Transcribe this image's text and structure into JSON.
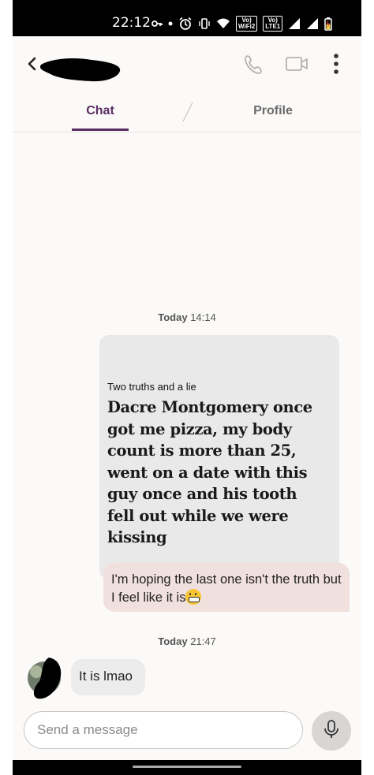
{
  "status_bar": {
    "time": "22:12",
    "wifi_badge": "Vo)\nWiFi2",
    "lte_badge": "Vo)\nLTE1"
  },
  "header": {
    "contact_name": "",
    "icons": [
      "back-arrow-icon",
      "phone-icon",
      "video-camera-icon",
      "more-vertical-icon"
    ]
  },
  "tabs": [
    {
      "label": "Chat",
      "active": true
    },
    {
      "label": "Profile",
      "active": false
    }
  ],
  "messages": {
    "timestamp_1_day": "Today",
    "timestamp_1_time": "14:14",
    "prompt_title": "Two truths and a lie",
    "prompt_answer": "Dacre Montgomery once got me pizza, my body count is more than 25, went on a date with this guy once and his tooth fell out while we were kissing",
    "reply_text": "I'm hoping the last one isn't the truth but I feel like it is",
    "reply_emoji": "grimacing-face",
    "timestamp_2_day": "Today",
    "timestamp_2_time": "21:47",
    "incoming_text": "It is lmao"
  },
  "composer": {
    "placeholder": "Send a message"
  },
  "colors": {
    "accent": "#5b2e63",
    "prompt_card": "#e9e9ea",
    "reply_bubble": "#f1e1de",
    "incoming_bubble": "#ececec",
    "background": "#fbfaf8"
  }
}
